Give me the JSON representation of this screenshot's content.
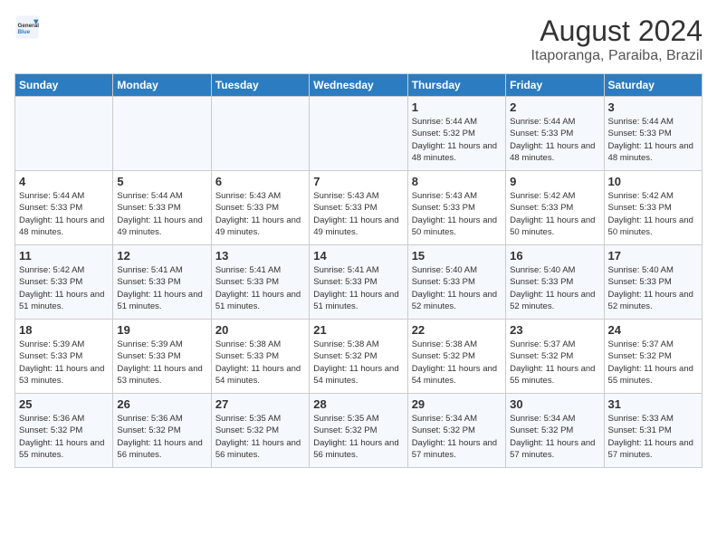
{
  "logo": {
    "text_general": "General",
    "text_blue": "Blue"
  },
  "title": "August 2024",
  "subtitle": "Itaporanga, Paraiba, Brazil",
  "days_of_week": [
    "Sunday",
    "Monday",
    "Tuesday",
    "Wednesday",
    "Thursday",
    "Friday",
    "Saturday"
  ],
  "weeks": [
    [
      {
        "day": "",
        "info": ""
      },
      {
        "day": "",
        "info": ""
      },
      {
        "day": "",
        "info": ""
      },
      {
        "day": "",
        "info": ""
      },
      {
        "day": "1",
        "info": "Sunrise: 5:44 AM\nSunset: 5:32 PM\nDaylight: 11 hours and 48 minutes."
      },
      {
        "day": "2",
        "info": "Sunrise: 5:44 AM\nSunset: 5:33 PM\nDaylight: 11 hours and 48 minutes."
      },
      {
        "day": "3",
        "info": "Sunrise: 5:44 AM\nSunset: 5:33 PM\nDaylight: 11 hours and 48 minutes."
      }
    ],
    [
      {
        "day": "4",
        "info": "Sunrise: 5:44 AM\nSunset: 5:33 PM\nDaylight: 11 hours and 48 minutes."
      },
      {
        "day": "5",
        "info": "Sunrise: 5:44 AM\nSunset: 5:33 PM\nDaylight: 11 hours and 49 minutes."
      },
      {
        "day": "6",
        "info": "Sunrise: 5:43 AM\nSunset: 5:33 PM\nDaylight: 11 hours and 49 minutes."
      },
      {
        "day": "7",
        "info": "Sunrise: 5:43 AM\nSunset: 5:33 PM\nDaylight: 11 hours and 49 minutes."
      },
      {
        "day": "8",
        "info": "Sunrise: 5:43 AM\nSunset: 5:33 PM\nDaylight: 11 hours and 50 minutes."
      },
      {
        "day": "9",
        "info": "Sunrise: 5:42 AM\nSunset: 5:33 PM\nDaylight: 11 hours and 50 minutes."
      },
      {
        "day": "10",
        "info": "Sunrise: 5:42 AM\nSunset: 5:33 PM\nDaylight: 11 hours and 50 minutes."
      }
    ],
    [
      {
        "day": "11",
        "info": "Sunrise: 5:42 AM\nSunset: 5:33 PM\nDaylight: 11 hours and 51 minutes."
      },
      {
        "day": "12",
        "info": "Sunrise: 5:41 AM\nSunset: 5:33 PM\nDaylight: 11 hours and 51 minutes."
      },
      {
        "day": "13",
        "info": "Sunrise: 5:41 AM\nSunset: 5:33 PM\nDaylight: 11 hours and 51 minutes."
      },
      {
        "day": "14",
        "info": "Sunrise: 5:41 AM\nSunset: 5:33 PM\nDaylight: 11 hours and 51 minutes."
      },
      {
        "day": "15",
        "info": "Sunrise: 5:40 AM\nSunset: 5:33 PM\nDaylight: 11 hours and 52 minutes."
      },
      {
        "day": "16",
        "info": "Sunrise: 5:40 AM\nSunset: 5:33 PM\nDaylight: 11 hours and 52 minutes."
      },
      {
        "day": "17",
        "info": "Sunrise: 5:40 AM\nSunset: 5:33 PM\nDaylight: 11 hours and 52 minutes."
      }
    ],
    [
      {
        "day": "18",
        "info": "Sunrise: 5:39 AM\nSunset: 5:33 PM\nDaylight: 11 hours and 53 minutes."
      },
      {
        "day": "19",
        "info": "Sunrise: 5:39 AM\nSunset: 5:33 PM\nDaylight: 11 hours and 53 minutes."
      },
      {
        "day": "20",
        "info": "Sunrise: 5:38 AM\nSunset: 5:33 PM\nDaylight: 11 hours and 54 minutes."
      },
      {
        "day": "21",
        "info": "Sunrise: 5:38 AM\nSunset: 5:32 PM\nDaylight: 11 hours and 54 minutes."
      },
      {
        "day": "22",
        "info": "Sunrise: 5:38 AM\nSunset: 5:32 PM\nDaylight: 11 hours and 54 minutes."
      },
      {
        "day": "23",
        "info": "Sunrise: 5:37 AM\nSunset: 5:32 PM\nDaylight: 11 hours and 55 minutes."
      },
      {
        "day": "24",
        "info": "Sunrise: 5:37 AM\nSunset: 5:32 PM\nDaylight: 11 hours and 55 minutes."
      }
    ],
    [
      {
        "day": "25",
        "info": "Sunrise: 5:36 AM\nSunset: 5:32 PM\nDaylight: 11 hours and 55 minutes."
      },
      {
        "day": "26",
        "info": "Sunrise: 5:36 AM\nSunset: 5:32 PM\nDaylight: 11 hours and 56 minutes."
      },
      {
        "day": "27",
        "info": "Sunrise: 5:35 AM\nSunset: 5:32 PM\nDaylight: 11 hours and 56 minutes."
      },
      {
        "day": "28",
        "info": "Sunrise: 5:35 AM\nSunset: 5:32 PM\nDaylight: 11 hours and 56 minutes."
      },
      {
        "day": "29",
        "info": "Sunrise: 5:34 AM\nSunset: 5:32 PM\nDaylight: 11 hours and 57 minutes."
      },
      {
        "day": "30",
        "info": "Sunrise: 5:34 AM\nSunset: 5:32 PM\nDaylight: 11 hours and 57 minutes."
      },
      {
        "day": "31",
        "info": "Sunrise: 5:33 AM\nSunset: 5:31 PM\nDaylight: 11 hours and 57 minutes."
      }
    ]
  ]
}
